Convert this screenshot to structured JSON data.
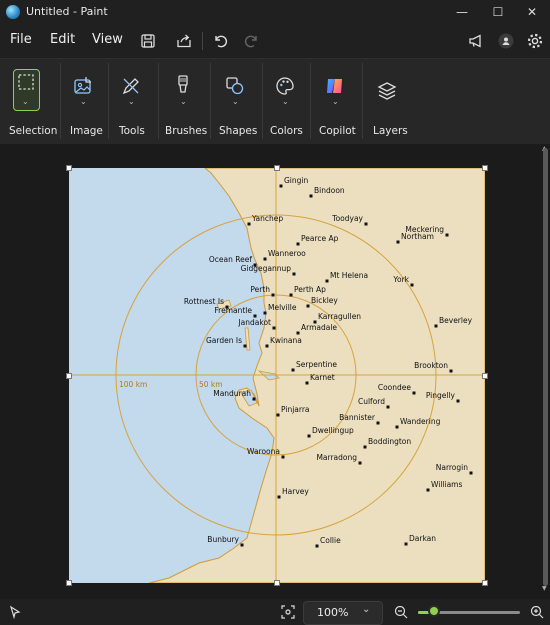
{
  "window": {
    "title": "Untitled - Paint",
    "minimize": "—",
    "maximize": "☐",
    "close": "✕"
  },
  "menu": {
    "file": "File",
    "edit": "Edit",
    "view": "View"
  },
  "ribbon": {
    "selection": "Selection",
    "image": "Image",
    "tools": "Tools",
    "brushes": "Brushes",
    "shapes": "Shapes",
    "colors": "Colors",
    "copilot": "Copilot",
    "layers": "Layers"
  },
  "colors": {
    "accent": "#8fd14f",
    "sea": "#c3d9ec",
    "land": "#ebdfc0",
    "ring": "#d8a23c"
  },
  "map": {
    "rings": [
      {
        "radius_km": 50,
        "label": "50 km"
      },
      {
        "radius_km": 100,
        "label": "100 km"
      }
    ],
    "places": [
      {
        "name": "Gingin"
      },
      {
        "name": "Bindoon"
      },
      {
        "name": "Toodyay"
      },
      {
        "name": "Yanchep"
      },
      {
        "name": "Meckering"
      },
      {
        "name": "Pearce Ap"
      },
      {
        "name": "Northam"
      },
      {
        "name": "Wanneroo"
      },
      {
        "name": "Ocean Reef"
      },
      {
        "name": "Gidgegannup"
      },
      {
        "name": "Mt Helena"
      },
      {
        "name": "York"
      },
      {
        "name": "Perth"
      },
      {
        "name": "Perth Ap"
      },
      {
        "name": "Rottnest Is"
      },
      {
        "name": "Bickley"
      },
      {
        "name": "Melville"
      },
      {
        "name": "Fremantle"
      },
      {
        "name": "Karragullen"
      },
      {
        "name": "Jandakot"
      },
      {
        "name": "Armadale"
      },
      {
        "name": "Beverley"
      },
      {
        "name": "Garden Is"
      },
      {
        "name": "Kwinana"
      },
      {
        "name": "Serpentine"
      },
      {
        "name": "Brookton"
      },
      {
        "name": "Karnet"
      },
      {
        "name": "Coondee"
      },
      {
        "name": "Mandurah"
      },
      {
        "name": "Culford"
      },
      {
        "name": "Pingelly"
      },
      {
        "name": "Pinjarra"
      },
      {
        "name": "Bannister"
      },
      {
        "name": "Wandering"
      },
      {
        "name": "Dwellingup"
      },
      {
        "name": "Boddington"
      },
      {
        "name": "Waroona"
      },
      {
        "name": "Marradong"
      },
      {
        "name": "Narrogin"
      },
      {
        "name": "Harvey"
      },
      {
        "name": "Williams"
      },
      {
        "name": "Bunbury"
      },
      {
        "name": "Darkan"
      },
      {
        "name": "Collie"
      }
    ]
  },
  "status": {
    "zoom": "100%",
    "zoom_fraction": 0.16
  }
}
